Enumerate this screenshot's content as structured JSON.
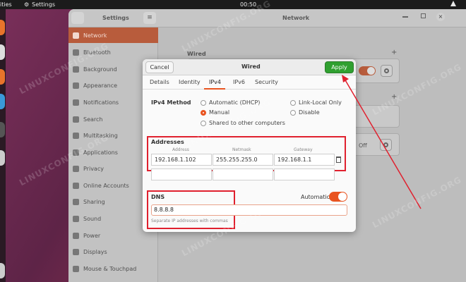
{
  "topbar": {
    "activities": "ities",
    "app_name": "Settings",
    "clock": "00:50"
  },
  "settings": {
    "title": "Settings",
    "panel_title": "Network",
    "sidebar": [
      {
        "label": "Network",
        "icon": "network-icon"
      },
      {
        "label": "Bluetooth",
        "icon": "bluetooth-icon"
      },
      {
        "label": "Background",
        "icon": "background-icon"
      },
      {
        "label": "Appearance",
        "icon": "appearance-icon"
      },
      {
        "label": "Notifications",
        "icon": "notifications-icon"
      },
      {
        "label": "Search",
        "icon": "search-icon"
      },
      {
        "label": "Multitasking",
        "icon": "multitasking-icon"
      },
      {
        "label": "Applications",
        "icon": "applications-icon"
      },
      {
        "label": "Privacy",
        "icon": "privacy-icon"
      },
      {
        "label": "Online Accounts",
        "icon": "online-accounts-icon"
      },
      {
        "label": "Sharing",
        "icon": "sharing-icon"
      },
      {
        "label": "Sound",
        "icon": "sound-icon"
      },
      {
        "label": "Power",
        "icon": "power-icon"
      },
      {
        "label": "Displays",
        "icon": "displays-icon"
      },
      {
        "label": "Mouse & Touchpad",
        "icon": "mouse-icon"
      }
    ],
    "main": {
      "wired_label": "Wired",
      "off_label": "Off"
    }
  },
  "dialog": {
    "cancel_label": "Cancel",
    "title": "Wired",
    "apply_label": "Apply",
    "tabs": [
      "Details",
      "Identity",
      "IPv4",
      "IPv6",
      "Security"
    ],
    "active_tab": "IPv4",
    "ipv4_method_label": "IPv4 Method",
    "methods": {
      "automatic": "Automatic (DHCP)",
      "link_local": "Link-Local Only",
      "manual": "Manual",
      "disable": "Disable",
      "shared": "Shared to other computers"
    },
    "selected_method": "Manual",
    "addresses_label": "Addresses",
    "columns": {
      "address": "Address",
      "netmask": "Netmask",
      "gateway": "Gateway"
    },
    "address_row": {
      "address": "192.168.1.102",
      "netmask": "255.255.255.0",
      "gateway": "192.168.1.1"
    },
    "dns_label": "DNS",
    "automatic_label": "Automatic",
    "dns_automatic": true,
    "dns_value": "8.8.8.8",
    "dns_hint": "Separate IP addresses with commas"
  },
  "watermark": "LINUXCONFIG.ORG",
  "colors": {
    "accent": "#e95420",
    "apply_green": "#30a030",
    "highlight_red": "#e0202e"
  }
}
